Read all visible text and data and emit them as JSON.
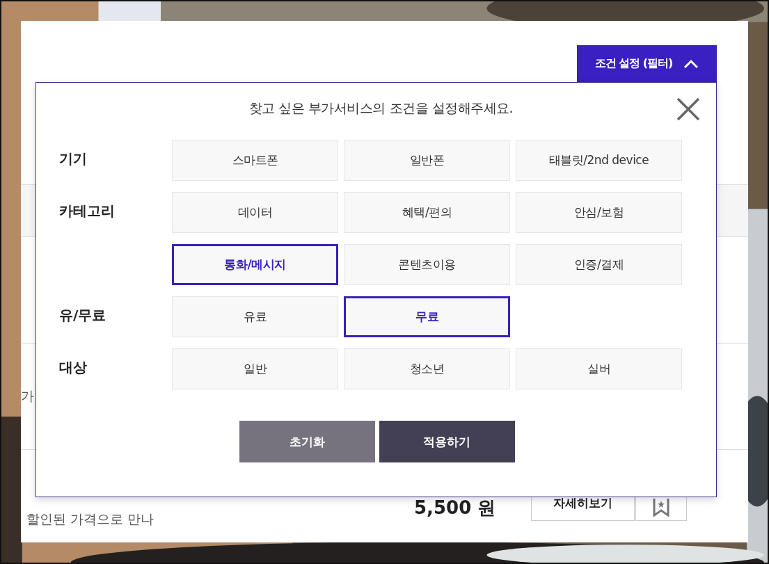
{
  "filter_toggle": {
    "label": "조건 설정 (필터)",
    "expanded": true
  },
  "background_list": {
    "row_text": "가",
    "description": "할인된 가격으로 만나",
    "price": "5,500 원",
    "detail_button": "자세히보기"
  },
  "filter_panel": {
    "title": "찾고 싶은 부가서비스의 조건을 설정해주세요.",
    "groups": [
      {
        "label": "기기",
        "options": [
          {
            "label": "스마트폰",
            "selected": false
          },
          {
            "label": "일반폰",
            "selected": false
          },
          {
            "label": "태블릿/2nd device",
            "selected": false
          }
        ]
      },
      {
        "label": "카테고리",
        "options": [
          {
            "label": "데이터",
            "selected": false
          },
          {
            "label": "혜택/편의",
            "selected": false
          },
          {
            "label": "안심/보험",
            "selected": false
          },
          {
            "label": "통화/메시지",
            "selected": true
          },
          {
            "label": "콘텐츠이용",
            "selected": false
          },
          {
            "label": "인증/결제",
            "selected": false
          }
        ]
      },
      {
        "label": "유/무료",
        "options": [
          {
            "label": "유료",
            "selected": false
          },
          {
            "label": "무료",
            "selected": true
          }
        ]
      },
      {
        "label": "대상",
        "options": [
          {
            "label": "일반",
            "selected": false
          },
          {
            "label": "청소년",
            "selected": false
          },
          {
            "label": "실버",
            "selected": false
          }
        ]
      }
    ],
    "buttons": [
      {
        "label": "초기화",
        "kind": "reset"
      },
      {
        "label": "적용하기",
        "kind": "apply"
      }
    ]
  }
}
